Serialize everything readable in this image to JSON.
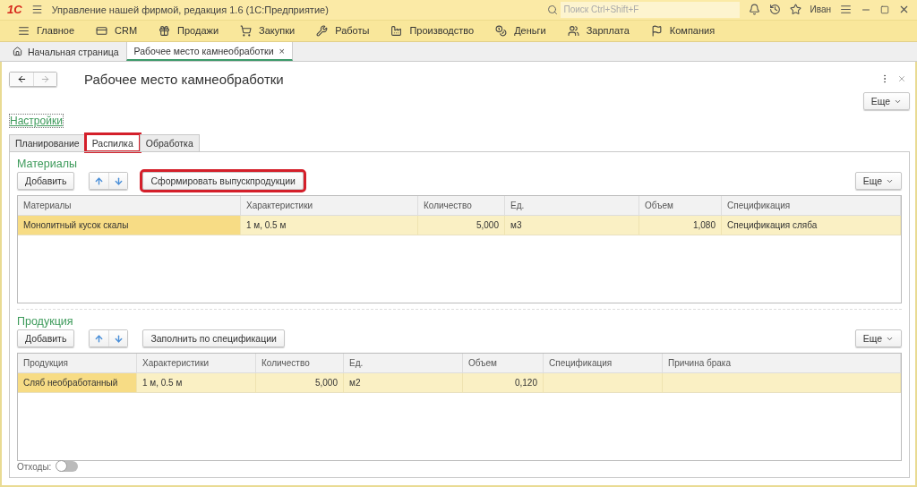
{
  "titlebar": {
    "logo": "1С",
    "title": "Управление нашей фирмой, редакция 1.6  (1С:Предприятие)",
    "search": {
      "placeholder": "Поиск Ctrl+Shift+F"
    },
    "user": "Иван"
  },
  "nav": [
    {
      "label": "Главное"
    },
    {
      "label": "CRM"
    },
    {
      "label": "Продажи"
    },
    {
      "label": "Закупки"
    },
    {
      "label": "Работы"
    },
    {
      "label": "Производство"
    },
    {
      "label": "Деньги"
    },
    {
      "label": "Зарплата"
    },
    {
      "label": "Компания"
    }
  ],
  "open_tabs": [
    {
      "label": "Начальная страница",
      "kind": "home",
      "selected": false
    },
    {
      "label": "Рабочее место камнеобработки",
      "kind": "doc",
      "selected": true,
      "close": "×"
    }
  ],
  "form": {
    "title": "Рабочее место камнеобработки",
    "more_button": "Еще",
    "settings_link": "Настройки",
    "tabs": [
      {
        "label": "Планирование",
        "selected": false,
        "highlighted": false
      },
      {
        "label": "Распилка",
        "selected": true,
        "highlighted": true
      },
      {
        "label": "Обработка",
        "selected": false,
        "highlighted": false
      }
    ],
    "sections": [
      {
        "title": "Материалы",
        "add_button": "Добавить",
        "action_button": {
          "label": "Сформировать выпускпродукции",
          "highlighted": true
        },
        "more_button": "Еще",
        "columns": [
          "Материалы",
          "Характеристики",
          "Количество",
          "Ед.",
          "Объем",
          "Спецификация"
        ],
        "rows": [
          {
            "cells": [
              "Монолитный кусок скалы",
              "1 м, 0.5 м",
              "5,000",
              "м3",
              "1,080",
              "Спецификация сляба"
            ],
            "selected": true
          }
        ]
      },
      {
        "title": "Продукция",
        "add_button": "Добавить",
        "action_button": {
          "label": "Заполнить по спецификации",
          "highlighted": false
        },
        "more_button": "Еще",
        "columns": [
          "Продукция",
          "Характеристики",
          "Количество",
          "Ед.",
          "Объем",
          "Спецификация",
          "Причина брака"
        ],
        "rows": [
          {
            "cells": [
              "Сляб необработанный",
              "1 м, 0.5 м",
              "5,000",
              "м2",
              "0,120",
              "",
              ""
            ],
            "selected": true
          }
        ]
      }
    ],
    "waste": {
      "label": "Отходы:",
      "on": false
    }
  }
}
